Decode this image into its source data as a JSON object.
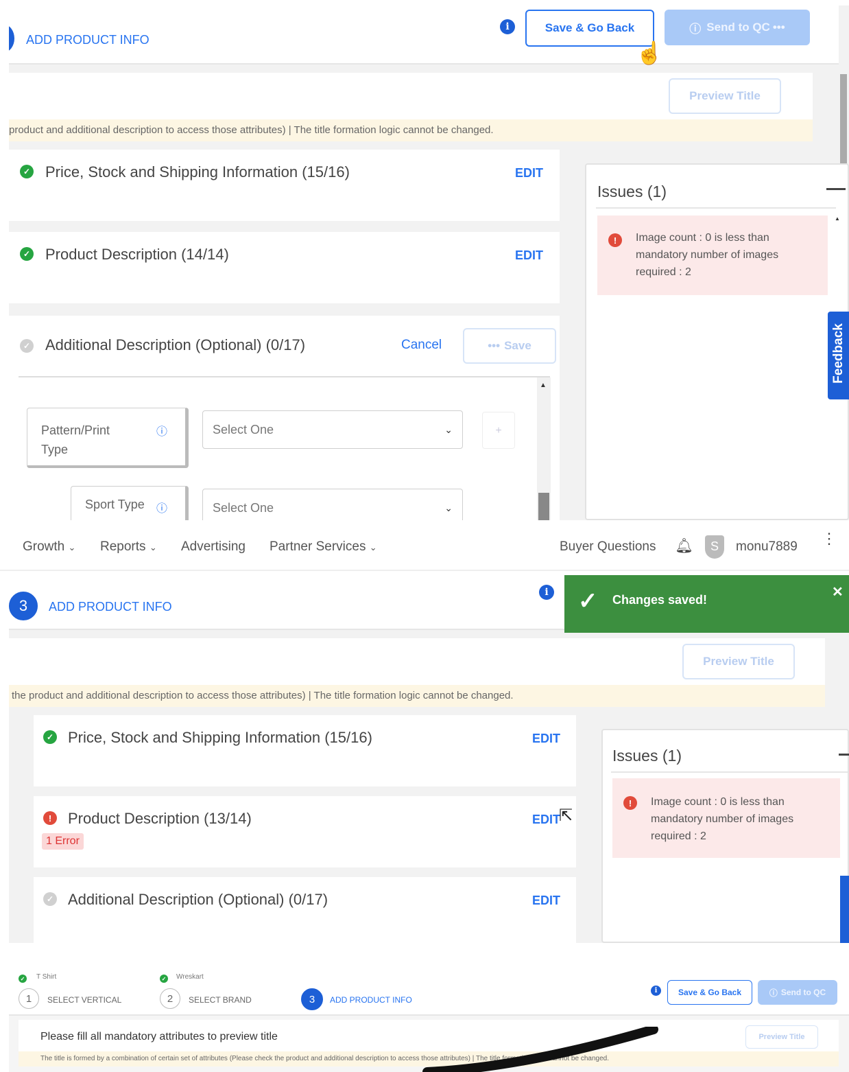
{
  "panel1": {
    "header_title": "ADD PRODUCT INFO",
    "save_back": "Save & Go Back",
    "send_qc": "Send to QC",
    "preview_title": "Preview Title",
    "banner": "product and additional description to access those attributes) | The title formation logic cannot be changed.",
    "sections": [
      {
        "title": "Price, Stock and Shipping Information (15/16)",
        "action": "EDIT"
      },
      {
        "title": "Product Description (14/14)",
        "action": "EDIT"
      },
      {
        "title": "Additional Description (Optional) (0/17)",
        "action": "Cancel",
        "save": "Save"
      }
    ],
    "attrs": [
      {
        "label": "Pattern/Print Type",
        "value": "Select One"
      },
      {
        "label": "Sport Type",
        "value": "Select One"
      }
    ],
    "issues_title": "Issues (1)",
    "issue_text": "Image count : 0 is less than mandatory number of images required : 2",
    "feedback": "Feedback"
  },
  "nav": {
    "items": [
      "Growth",
      "Reports",
      "Advertising",
      "Partner Services"
    ],
    "buyer_questions": "Buyer Questions",
    "avatar_letter": "S",
    "username": "monu7889"
  },
  "panel2": {
    "step_number": "3",
    "header_title": "ADD PRODUCT INFO",
    "toast": "Changes saved!",
    "preview_title": "Preview Title",
    "banner": "the product and additional description to access those attributes) | The title formation logic cannot be changed.",
    "sections": [
      {
        "title": "Price, Stock and Shipping Information (15/16)",
        "action": "EDIT"
      },
      {
        "title": "Product Description (13/14)",
        "action": "EDIT",
        "error_badge": "1 Error"
      },
      {
        "title": "Additional Description (Optional) (0/17)",
        "action": "EDIT"
      }
    ],
    "issues_title": "Issues (1)",
    "issue_text": "Image count : 0 is less than mandatory number of images required : 2"
  },
  "panel3": {
    "steps": [
      {
        "num": "1",
        "label": "SELECT VERTICAL",
        "done_value": "T Shirt"
      },
      {
        "num": "2",
        "label": "SELECT BRAND",
        "done_value": "Wreskart"
      },
      {
        "num": "3",
        "label": "ADD PRODUCT INFO"
      }
    ],
    "save_back": "Save & Go Back",
    "send_qc": "Send to QC",
    "fill_msg": "Please fill all mandatory attributes to preview title",
    "preview_title": "Preview Title",
    "banner": "The title is formed by a combination of certain set of attributes (Please check the product and additional description to access those attributes) | The title formation logic cannot be changed."
  },
  "colors": {
    "primary": "#2874f0",
    "success": "#26a541",
    "error": "#e14b3b",
    "toast": "#3c8f3f",
    "banner": "#fdf6e3",
    "issue_bg": "#fce9e9"
  }
}
